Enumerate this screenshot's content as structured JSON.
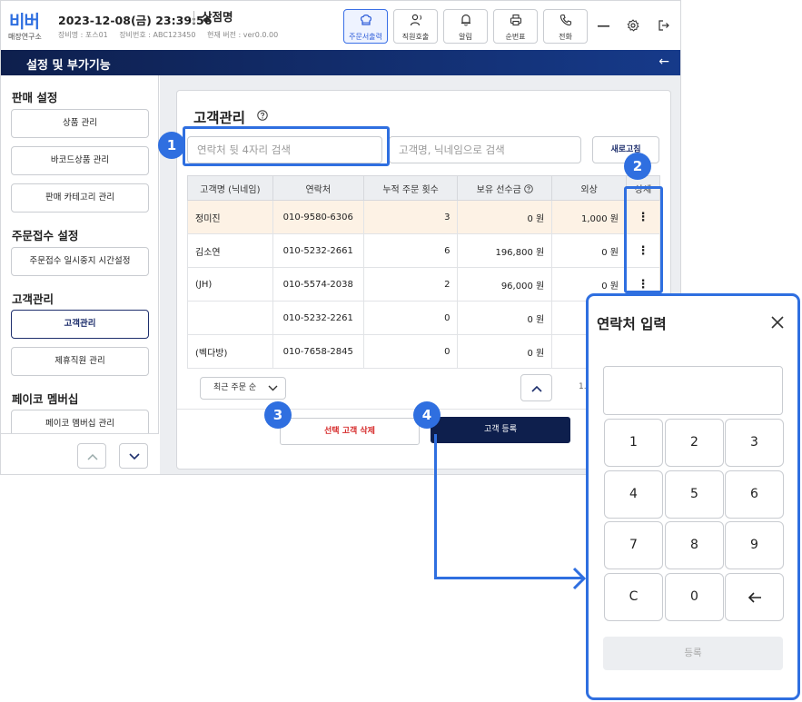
{
  "app": {
    "logo_mark": "비버",
    "logo_sub": "매장연구소",
    "datetime": "2023-12-08(금)  23:39:56",
    "store_name": "상점명",
    "device_name": "장비명 : 포스01",
    "device_number": "장비번호 : ABC123450",
    "version": "현재 버전 : ver0.0.00"
  },
  "toolbar": {
    "order_print": "주문서출력",
    "staff_call": "직원호출",
    "notification": "알림",
    "queue_number": "순번표",
    "phone": "전화"
  },
  "nav": {
    "title": "설정 및 부가기능",
    "back": "←"
  },
  "sidebar": {
    "sections": [
      {
        "title": "판매 설정",
        "items": [
          "상품 관리",
          "바코드상품 관리",
          "판매 카테고리 관리"
        ]
      },
      {
        "title": "주문접수 설정",
        "items": [
          "주문접수 일시중지 시간설정"
        ]
      },
      {
        "title": "고객관리",
        "items": [
          "고객관리",
          "제휴직원 관리"
        ]
      },
      {
        "title": "페이코 멤버십",
        "items": [
          "페이코 멤버십 관리"
        ]
      }
    ]
  },
  "main": {
    "title": "고객관리",
    "phone_search_placeholder": "연락처 뒷 4자리 검색",
    "name_search_placeholder": "고객명, 닉네임으로 검색",
    "refresh": "새로고침",
    "columns": [
      "고객명 (닉네임)",
      "연락처",
      "누적 주문 횟수",
      "보유 선수금",
      "외상",
      "상세"
    ],
    "rows": [
      {
        "name": "정미진",
        "phone": "010-9580-6306",
        "orders": "3",
        "prepaid": "0 원",
        "credit": "1,000 원"
      },
      {
        "name": "김소연",
        "phone": "010-5232-2661",
        "orders": "6",
        "prepaid": "196,800 원",
        "credit": "0 원"
      },
      {
        "name": "(JH)",
        "phone": "010-5574-2038",
        "orders": "2",
        "prepaid": "96,000 원",
        "credit": "0 원"
      },
      {
        "name": "",
        "phone": "010-5232-2261",
        "orders": "0",
        "prepaid": "0 원",
        "credit": "0 원"
      },
      {
        "name": "(벡다방)",
        "phone": "010-7658-2845",
        "orders": "0",
        "prepaid": "0 원",
        "credit": "0 원"
      }
    ],
    "sort_label": "최근 주문 순",
    "page_text": "1.",
    "delete_selected": "선택 고객 삭제",
    "register_customer": "고객 등록"
  },
  "badges": [
    "1",
    "2",
    "3",
    "4"
  ],
  "popup": {
    "title": "연락처 입력",
    "keys": [
      "1",
      "2",
      "3",
      "4",
      "5",
      "6",
      "7",
      "8",
      "9",
      "C",
      "0"
    ],
    "submit": "등록"
  },
  "colors": {
    "accent": "#2f6fe0",
    "navy": "#0e1f4d",
    "danger": "#d62b2b",
    "selected_row": "#fdf2e5"
  }
}
